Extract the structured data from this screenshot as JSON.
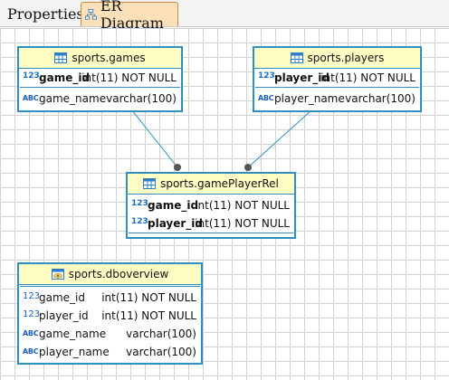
{
  "tabs": [
    {
      "label": "Properties",
      "icon": "database-icon"
    },
    {
      "label": "ER Diagram",
      "icon": "er-diagram-icon",
      "active": true
    }
  ],
  "entities": {
    "games": {
      "title": "sports.games",
      "columns": [
        {
          "name": "game_id",
          "type": "int(11) NOT NULL",
          "icon": "123",
          "key": true
        },
        {
          "name": "game_name",
          "type": "varchar(100)",
          "icon": "ABC",
          "key": false
        }
      ]
    },
    "players": {
      "title": "sports.players",
      "columns": [
        {
          "name": "player_id",
          "type": "int(11) NOT NULL",
          "icon": "123",
          "key": true
        },
        {
          "name": "player_name",
          "type": "varchar(100)",
          "icon": "ABC",
          "key": false
        }
      ]
    },
    "gamePlayerRel": {
      "title": "sports.gamePlayerRel",
      "columns": [
        {
          "name": "game_id",
          "type": "int(11) NOT NULL",
          "icon": "123",
          "key": true
        },
        {
          "name": "player_id",
          "type": "int(11) NOT NULL",
          "icon": "123",
          "key": true
        }
      ]
    },
    "dboverview": {
      "title": "sports.dboverview",
      "columns": [
        {
          "name": "game_id",
          "type": "int(11) NOT NULL",
          "icon": "123",
          "key": false
        },
        {
          "name": "player_id",
          "type": "int(11) NOT NULL",
          "icon": "123",
          "key": false
        },
        {
          "name": "game_name",
          "type": "varchar(100)",
          "icon": "ABC",
          "key": false
        },
        {
          "name": "player_name",
          "type": "varchar(100)",
          "icon": "ABC",
          "key": false
        }
      ]
    }
  },
  "colors": {
    "entity_border": "#2f8fbf",
    "header_bg": "#fffdc4",
    "active_tab_bg": "#fbe0b8",
    "link": "#2f8fbf"
  }
}
